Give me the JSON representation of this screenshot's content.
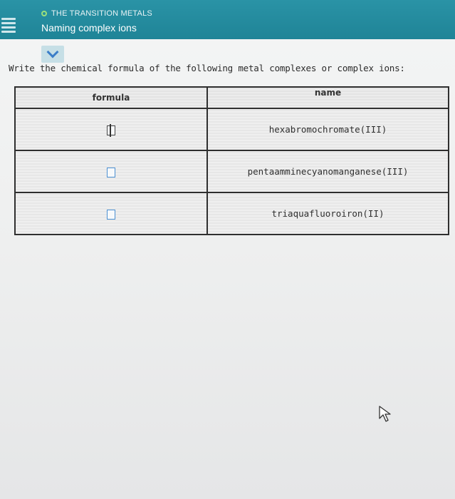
{
  "header": {
    "topic": "THE TRANSITION METALS",
    "title": "Naming complex ions"
  },
  "prompt": "Write the chemical formula of the following metal complexes or complex ions:",
  "table": {
    "columns": [
      "formula",
      "name"
    ],
    "rows": [
      {
        "name": "hexabromochromate(III)"
      },
      {
        "name": "pentaamminecyanomanganese(III)"
      },
      {
        "name": "triaquafluoroiron(II)"
      }
    ]
  },
  "colors": {
    "header_bg": "#1f8497",
    "accent_dot": "#9be07c",
    "input_border": "#4c90d2"
  },
  "icons": [
    "menu-icon",
    "status-dot-icon",
    "chevron-down-icon",
    "mouse-pointer-icon"
  ]
}
